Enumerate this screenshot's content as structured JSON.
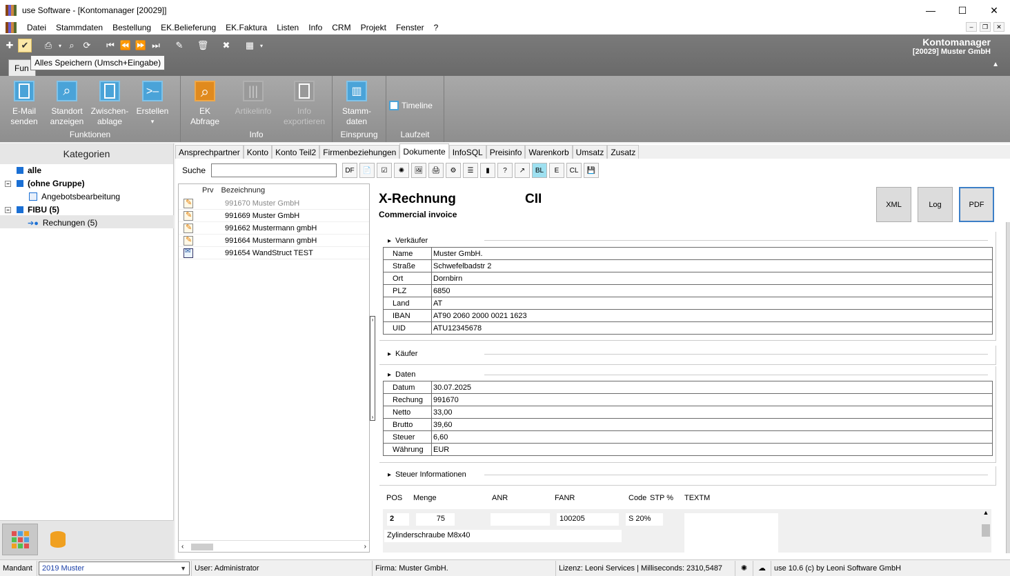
{
  "window": {
    "title": "use Software - [Kontomanager [20029]]",
    "minimize": "—",
    "maximize": "☐",
    "close": "✕"
  },
  "menu": [
    "Datei",
    "Stammdaten",
    "Bestellung",
    "EK.Belieferung",
    "EK.Faktura",
    "Listen",
    "Info",
    "CRM",
    "Projekt",
    "Fenster",
    "?"
  ],
  "header": {
    "module_title": "Kontomanager",
    "module_subtitle": "[20029] Muster GmbH",
    "tab_label": "Fun",
    "tooltip": "Alles Speichern (Umsch+Eingabe)"
  },
  "ribbon": {
    "groups": [
      {
        "label": "Funktionen",
        "buttons": [
          {
            "label1": "E-Mail",
            "label2": "senden"
          },
          {
            "label1": "Standort",
            "label2": "anzeigen"
          },
          {
            "label1": "Zwischen-",
            "label2": "ablage"
          },
          {
            "label1": "Erstellen",
            "label2": "▾"
          }
        ]
      },
      {
        "label": "Info",
        "buttons": [
          {
            "label1": "EK",
            "label2": "Abfrage"
          },
          {
            "label1": "Artikelinfo",
            "label2": ""
          },
          {
            "label1": "Info",
            "label2": "exportieren"
          }
        ]
      },
      {
        "label": "Einsprung",
        "buttons": [
          {
            "label1": "Stamm-",
            "label2": "daten"
          }
        ]
      },
      {
        "label": "Laufzeit",
        "timeline": "Timeline"
      }
    ]
  },
  "left": {
    "header": "Kategorien",
    "tree": [
      {
        "label": "alle"
      },
      {
        "label": "(ohne Gruppe)"
      },
      {
        "label": "Angebotsbearbeitung"
      },
      {
        "label": "FIBU (5)"
      },
      {
        "label": "Rechungen (5)"
      }
    ]
  },
  "tabs": [
    "Ansprechpartner",
    "Konto",
    "Konto Teil2",
    "Firmenbeziehungen",
    "Dokumente",
    "InfoSQL",
    "Preisinfo",
    "Warenkorb",
    "Umsatz",
    "Zusatz"
  ],
  "search": {
    "label": "Suche",
    "value": "",
    "df": "DF",
    "e": "E",
    "cl": "CL",
    "bl": "BL"
  },
  "doclist": {
    "col_prv": "Prv",
    "col_name": "Bezeichnung",
    "rows": [
      {
        "label": "991670 Muster GmbH"
      },
      {
        "label": "991669 Muster GmbH"
      },
      {
        "label": "991662 Mustermann gmbH"
      },
      {
        "label": "991664 Mustermann gmbH"
      },
      {
        "label": "991654 WandStruct TEST"
      }
    ]
  },
  "invoice": {
    "title": "X-Rechnung",
    "format": "CII",
    "subtitle": "Commercial invoice",
    "buttons": {
      "xml": "XML",
      "log": "Log",
      "pdf": "PDF"
    },
    "seller_head": "Verkäufer",
    "seller": [
      {
        "k": "Name",
        "v": "Muster GmbH."
      },
      {
        "k": "Straße",
        "v": "Schwefelbadstr 2"
      },
      {
        "k": "Ort",
        "v": "Dornbirn"
      },
      {
        "k": "PLZ",
        "v": "6850"
      },
      {
        "k": "Land",
        "v": "AT"
      },
      {
        "k": "IBAN",
        "v": "AT90 2060 2000 0021 1623"
      },
      {
        "k": "UID",
        "v": "ATU12345678"
      }
    ],
    "buyer_head": "Käufer",
    "data_head": "Daten",
    "data": [
      {
        "k": "Datum",
        "v": "30.07.2025"
      },
      {
        "k": "Rechung",
        "v": "991670"
      },
      {
        "k": "Netto",
        "v": "33,00"
      },
      {
        "k": "Brutto",
        "v": "39,60"
      },
      {
        "k": "Steuer",
        "v": "6,60"
      },
      {
        "k": "Währung",
        "v": "EUR"
      }
    ],
    "tax_head": "Steuer Informationen",
    "pos_cols": {
      "pos": "POS",
      "menge": "Menge",
      "anr": "ANR",
      "fanr": "FANR",
      "code": "Code",
      "stp": "STP %",
      "textm": "TEXTM"
    },
    "pos_row": {
      "pos": "2",
      "menge": "75",
      "anr": "",
      "fanr": "100205",
      "code": "S 20%",
      "text": "Zylinderschraube M8x40"
    }
  },
  "status": {
    "mandant_label": "Mandant",
    "mandant_value": "2019 Muster",
    "user": "User: Administrator",
    "firma": "Firma: Muster GmbH.",
    "lizenz": "Lizenz: Leoni Services | Milliseconds: 2310,5487",
    "version": "use 10.6 (c) by Leoni Software GmbH"
  },
  "colors": {
    "accent": "#4aa3d8",
    "ribbon": "#9a9a9a",
    "orange": "#e08a1e",
    "tree_blue": "#1a6fd4"
  }
}
